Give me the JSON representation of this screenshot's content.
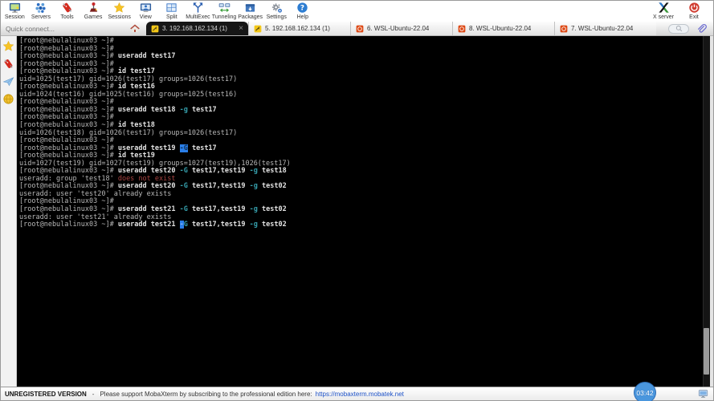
{
  "toolbar": {
    "items": [
      {
        "label": "Session",
        "icon": "session-icon"
      },
      {
        "label": "Servers",
        "icon": "servers-icon"
      },
      {
        "label": "Tools",
        "icon": "tools-icon"
      },
      {
        "label": "Games",
        "icon": "games-icon"
      },
      {
        "label": "Sessions",
        "icon": "sessions-icon"
      },
      {
        "label": "View",
        "icon": "view-icon"
      },
      {
        "label": "Split",
        "icon": "split-icon"
      },
      {
        "label": "MultiExec",
        "icon": "multiexec-icon"
      },
      {
        "label": "Tunneling",
        "icon": "tunneling-icon"
      },
      {
        "label": "Packages",
        "icon": "packages-icon"
      },
      {
        "label": "Settings",
        "icon": "settings-icon"
      },
      {
        "label": "Help",
        "icon": "help-icon"
      }
    ],
    "right_items": [
      {
        "label": "X server",
        "icon": "x-server-icon"
      },
      {
        "label": "Exit",
        "icon": "exit-icon"
      }
    ]
  },
  "tabbar": {
    "quick_connect_placeholder": "Quick connect...",
    "tabs": [
      {
        "label": "3. 192.168.162.134 (1)",
        "icon": "ssh-session-icon",
        "active": true,
        "close_label": "×"
      },
      {
        "label": "5. 192.168.162.134 (1)",
        "icon": "ssh-session-icon",
        "active": false
      },
      {
        "label": "6. WSL-Ubuntu-22.04",
        "icon": "wsl-session-icon",
        "active": false
      },
      {
        "label": "8. WSL-Ubuntu-22.04",
        "icon": "wsl-session-icon",
        "active": false
      },
      {
        "label": "7. WSL-Ubuntu-22.04",
        "icon": "wsl-session-icon",
        "active": false
      }
    ]
  },
  "sidebar": {
    "items": [
      {
        "icon": "star-icon"
      },
      {
        "icon": "knife-icon"
      },
      {
        "icon": "paper-plane-icon"
      },
      {
        "icon": "globe-icon"
      }
    ]
  },
  "terminal": {
    "lines": [
      [
        [
          "p",
          "[root@nebulalinux03 ~]# "
        ]
      ],
      [
        [
          "p",
          "[root@nebulalinux03 ~]# "
        ]
      ],
      [
        [
          "p",
          "[root@nebulalinux03 ~]# "
        ],
        [
          "c",
          "useradd test17"
        ]
      ],
      [
        [
          "p",
          "[root@nebulalinux03 ~]# "
        ]
      ],
      [
        [
          "p",
          "[root@nebulalinux03 ~]# "
        ],
        [
          "c",
          "id test17"
        ]
      ],
      [
        [
          "o",
          "uid=1025(test17) gid=1026(test17) groups=1026(test17)"
        ]
      ],
      [
        [
          "p",
          "[root@nebulalinux03 ~]# "
        ],
        [
          "c",
          "id test16"
        ]
      ],
      [
        [
          "o",
          "uid=1024(test16) gid=1025(test16) groups=1025(test16)"
        ]
      ],
      [
        [
          "p",
          "[root@nebulalinux03 ~]# "
        ]
      ],
      [
        [
          "p",
          "[root@nebulalinux03 ~]# "
        ],
        [
          "c",
          "useradd test18 "
        ],
        [
          "t",
          "-g"
        ],
        [
          "c",
          " test17"
        ]
      ],
      [
        [
          "p",
          "[root@nebulalinux03 ~]# "
        ]
      ],
      [
        [
          "p",
          "[root@nebulalinux03 ~]# "
        ],
        [
          "c",
          "id test18"
        ]
      ],
      [
        [
          "o",
          "uid=1026(test18) gid=1026(test17) groups=1026(test17)"
        ]
      ],
      [
        [
          "p",
          "[root@nebulalinux03 ~]# "
        ]
      ],
      [
        [
          "p",
          "[root@nebulalinux03 ~]# "
        ],
        [
          "c",
          "useradd test19 "
        ],
        [
          "s",
          "-G"
        ],
        [
          "c",
          " test17"
        ]
      ],
      [
        [
          "p",
          "[root@nebulalinux03 ~]# "
        ],
        [
          "c",
          "id test19"
        ]
      ],
      [
        [
          "o",
          "uid=1027(test19) gid=1027(test19) groups=1027(test19),1026(test17)"
        ]
      ],
      [
        [
          "p",
          "[root@nebulalinux03 ~]# "
        ],
        [
          "c",
          "useradd test20 "
        ],
        [
          "t",
          "-G"
        ],
        [
          "c",
          " test17,test19 "
        ],
        [
          "t",
          "-g"
        ],
        [
          "c",
          " test18"
        ]
      ],
      [
        [
          "o",
          "useradd: group 'test18' "
        ],
        [
          "e",
          "does not exist"
        ]
      ],
      [
        [
          "p",
          "[root@nebulalinux03 ~]# "
        ],
        [
          "c",
          "useradd test20 "
        ],
        [
          "t",
          "-G"
        ],
        [
          "c",
          " test17,test19 "
        ],
        [
          "t",
          "-g"
        ],
        [
          "c",
          " test02"
        ]
      ],
      [
        [
          "o",
          "useradd: user 'test20' already exists"
        ]
      ],
      [
        [
          "p",
          "[root@nebulalinux03 ~]# "
        ]
      ],
      [
        [
          "p",
          "[root@nebulalinux03 ~]# "
        ],
        [
          "c",
          "useradd test21 "
        ],
        [
          "t",
          "-G"
        ],
        [
          "c",
          " test17,test19 "
        ],
        [
          "t",
          "-g"
        ],
        [
          "c",
          " test02"
        ]
      ],
      [
        [
          "o",
          "useradd: user 'test21' already exists"
        ]
      ],
      [
        [
          "p",
          "[root@nebulalinux03 ~]# "
        ],
        [
          "c",
          "useradd test21 "
        ],
        [
          "k",
          "-"
        ],
        [
          "t",
          "G"
        ],
        [
          "c",
          " test17,test19 "
        ],
        [
          "t",
          "-g"
        ],
        [
          "c",
          " test02"
        ]
      ]
    ]
  },
  "statusbar": {
    "version_label": "UNREGISTERED VERSION",
    "separator": "-",
    "message": "Please support MobaXterm by subscribing to the professional edition here:",
    "link": "https://mobaxterm.mobatek.net",
    "clock": "03:42"
  },
  "colors": {
    "terminal_background": "#000000",
    "terminal_text": "#b8b8b8",
    "option_teal": "#36a0ad",
    "error_red": "#a94442",
    "selection_blue": "#2a7ee8",
    "clock_blue": "#4a96dd",
    "active_tab": "#161616",
    "link_blue": "#1d52c8"
  }
}
